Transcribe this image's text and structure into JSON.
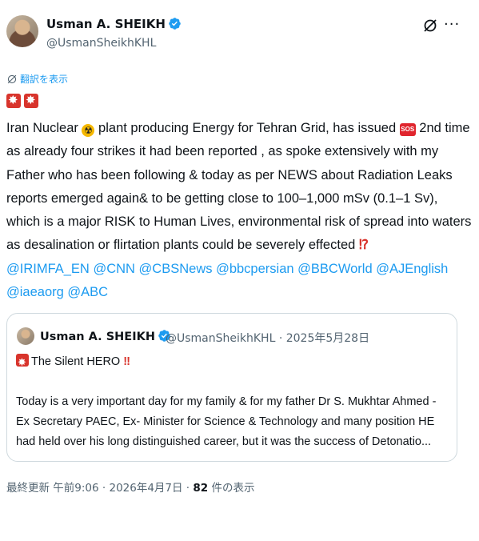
{
  "author": {
    "name": "Usman A. SHEIKH",
    "handle": "@UsmanSheikhKHL"
  },
  "translate_label": "翻訳を表示",
  "tweet": {
    "seg1": "Iran Nuclear ",
    "seg2": " plant producing Energy for Tehran Grid, has issued ",
    "seg3": " 2nd time as already four strikes it had been reported , as spoke extensively with my Father who has been following & today as per NEWS about Radiation Leaks reports emerged again& to be getting close to 100–1,000 mSv (0.1–1 Sv), which is a major RISK to Human Lives, environmental risk of spread into waters as desalination or flirtation plants could be severely effected ",
    "excl": "⁉",
    "mentions": [
      "@IRIMFA_EN",
      "@CNN",
      "@CBSNews",
      "@bbcpersian",
      "@BBCWorld",
      "@AJEnglish",
      "@iaeaorg",
      "@ABC"
    ]
  },
  "quote": {
    "name": "Usman A. SHEIKH",
    "meta": "@UsmanSheikhKHL · 2025年5月28日",
    "line1": "The Silent HERO ",
    "line1_excl": "‼",
    "body1": "Today is a very important day for my family & for my father Dr S. Mukhtar Ahmed - Ex Secretary PAEC, Ex- Minister for Science & Technology and many position HE had held over his long distinguished career, but it was the success of Detonatio..."
  },
  "footer": {
    "updated": "最終更新 午前9:06 · 2026年4月7日 · ",
    "views": "82",
    "views_label": " 件の表示"
  },
  "colors": {
    "link": "#1d9bf0",
    "verified": "#1d9bf0",
    "secondary_text": "#536471",
    "border": "#cfd9de"
  }
}
